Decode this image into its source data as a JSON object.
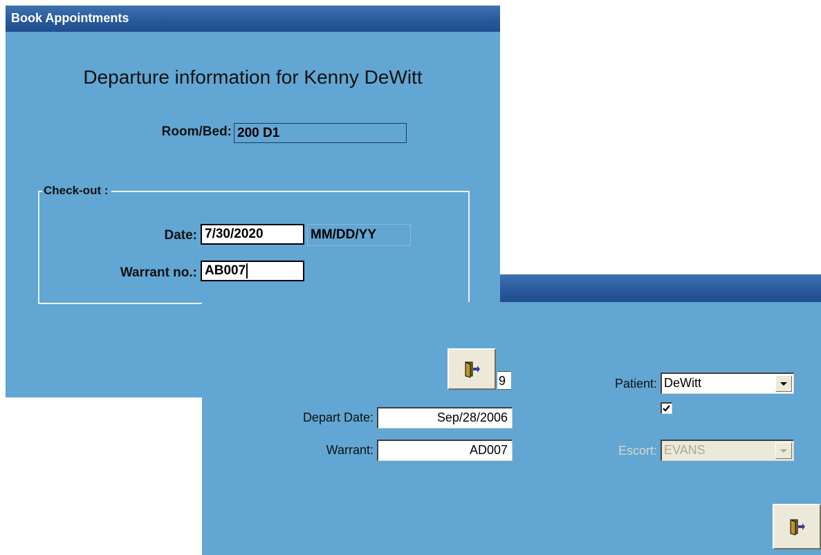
{
  "back_window": {
    "title": "Book Appointments",
    "heading": "Departure information for Kenny DeWitt",
    "room_bed": {
      "label": "Room/Bed:",
      "value": "200 D1"
    },
    "checkout": {
      "legend": "Check-out :",
      "date_label": "Date:",
      "date_value": "7/30/2020",
      "date_format": "MM/DD/YY",
      "warrant_label": "Warrant no.:",
      "warrant_value": "AB007"
    }
  },
  "front_window": {
    "partial_field_value": "9",
    "depart_date": {
      "label": "Depart Date:",
      "value": "Sep/28/2006"
    },
    "warrant": {
      "label": "Warrant:",
      "value": "AD007"
    },
    "patient": {
      "label": "Patient:",
      "selected": "DeWitt"
    },
    "checkbox": {
      "checked": true
    },
    "escort": {
      "label": "Escort:",
      "selected": "EVANS",
      "disabled": true
    }
  },
  "icons": [
    "exit-door-icon",
    "checkmark-icon",
    "chevron-down-icon"
  ],
  "colors": {
    "panel_bg": "#62a6d3",
    "titlebar": "#2a5a9c",
    "button_face": "#ece9d8"
  }
}
